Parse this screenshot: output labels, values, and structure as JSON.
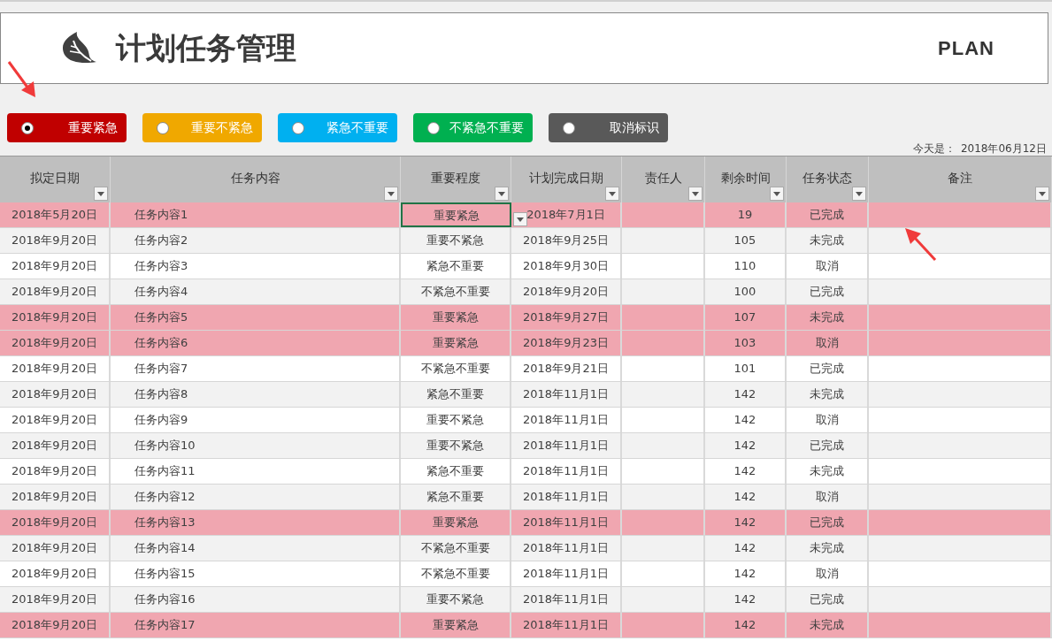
{
  "header": {
    "title": "计划任务管理",
    "badge": "PLAN"
  },
  "filters": [
    {
      "label": "重要紧急",
      "color": "#c00000",
      "selected": true
    },
    {
      "label": "重要不紧急",
      "color": "#f0a800",
      "selected": false
    },
    {
      "label": "紧急不重要",
      "color": "#00b0f0",
      "selected": false
    },
    {
      "label": "不紧急不重要",
      "color": "#00b050",
      "selected": false
    },
    {
      "label": "取消标识",
      "color": "#595959",
      "selected": false
    }
  ],
  "today": {
    "label": "今天是：",
    "date": "2018年06月12日"
  },
  "table": {
    "columns": [
      "拟定日期",
      "任务内容",
      "重要程度",
      "计划完成日期",
      "责任人",
      "剩余时间",
      "任务状态",
      "备注"
    ],
    "rows": [
      {
        "date": "2018年5月20日",
        "content": "任务内容1",
        "importance": "重要紧急",
        "due": "2018年7月1日",
        "remaining": "19",
        "status": "已完成",
        "highlighted": true,
        "selected": true
      },
      {
        "date": "2018年9月20日",
        "content": "任务内容2",
        "importance": "重要不紧急",
        "due": "2018年9月25日",
        "remaining": "105",
        "status": "未完成",
        "highlighted": false,
        "selected": false
      },
      {
        "date": "2018年9月20日",
        "content": "任务内容3",
        "importance": "紧急不重要",
        "due": "2018年9月30日",
        "remaining": "110",
        "status": "取消",
        "highlighted": false,
        "selected": false
      },
      {
        "date": "2018年9月20日",
        "content": "任务内容4",
        "importance": "不紧急不重要",
        "due": "2018年9月20日",
        "remaining": "100",
        "status": "已完成",
        "highlighted": false,
        "selected": false
      },
      {
        "date": "2018年9月20日",
        "content": "任务内容5",
        "importance": "重要紧急",
        "due": "2018年9月27日",
        "remaining": "107",
        "status": "未完成",
        "highlighted": true,
        "selected": false
      },
      {
        "date": "2018年9月20日",
        "content": "任务内容6",
        "importance": "重要紧急",
        "due": "2018年9月23日",
        "remaining": "103",
        "status": "取消",
        "highlighted": true,
        "selected": false
      },
      {
        "date": "2018年9月20日",
        "content": "任务内容7",
        "importance": "不紧急不重要",
        "due": "2018年9月21日",
        "remaining": "101",
        "status": "已完成",
        "highlighted": false,
        "selected": false
      },
      {
        "date": "2018年9月20日",
        "content": "任务内容8",
        "importance": "紧急不重要",
        "due": "2018年11月1日",
        "remaining": "142",
        "status": "未完成",
        "highlighted": false,
        "selected": false
      },
      {
        "date": "2018年9月20日",
        "content": "任务内容9",
        "importance": "重要不紧急",
        "due": "2018年11月1日",
        "remaining": "142",
        "status": "取消",
        "highlighted": false,
        "selected": false
      },
      {
        "date": "2018年9月20日",
        "content": "任务内容10",
        "importance": "重要不紧急",
        "due": "2018年11月1日",
        "remaining": "142",
        "status": "已完成",
        "highlighted": false,
        "selected": false
      },
      {
        "date": "2018年9月20日",
        "content": "任务内容11",
        "importance": "紧急不重要",
        "due": "2018年11月1日",
        "remaining": "142",
        "status": "未完成",
        "highlighted": false,
        "selected": false
      },
      {
        "date": "2018年9月20日",
        "content": "任务内容12",
        "importance": "紧急不重要",
        "due": "2018年11月1日",
        "remaining": "142",
        "status": "取消",
        "highlighted": false,
        "selected": false
      },
      {
        "date": "2018年9月20日",
        "content": "任务内容13",
        "importance": "重要紧急",
        "due": "2018年11月1日",
        "remaining": "142",
        "status": "已完成",
        "highlighted": true,
        "selected": false
      },
      {
        "date": "2018年9月20日",
        "content": "任务内容14",
        "importance": "不紧急不重要",
        "due": "2018年11月1日",
        "remaining": "142",
        "status": "未完成",
        "highlighted": false,
        "selected": false
      },
      {
        "date": "2018年9月20日",
        "content": "任务内容15",
        "importance": "不紧急不重要",
        "due": "2018年11月1日",
        "remaining": "142",
        "status": "取消",
        "highlighted": false,
        "selected": false
      },
      {
        "date": "2018年9月20日",
        "content": "任务内容16",
        "importance": "重要不紧急",
        "due": "2018年11月1日",
        "remaining": "142",
        "status": "已完成",
        "highlighted": false,
        "selected": false
      },
      {
        "date": "2018年9月20日",
        "content": "任务内容17",
        "importance": "重要紧急",
        "due": "2018年11月1日",
        "remaining": "142",
        "status": "未完成",
        "highlighted": true,
        "selected": false
      }
    ]
  }
}
